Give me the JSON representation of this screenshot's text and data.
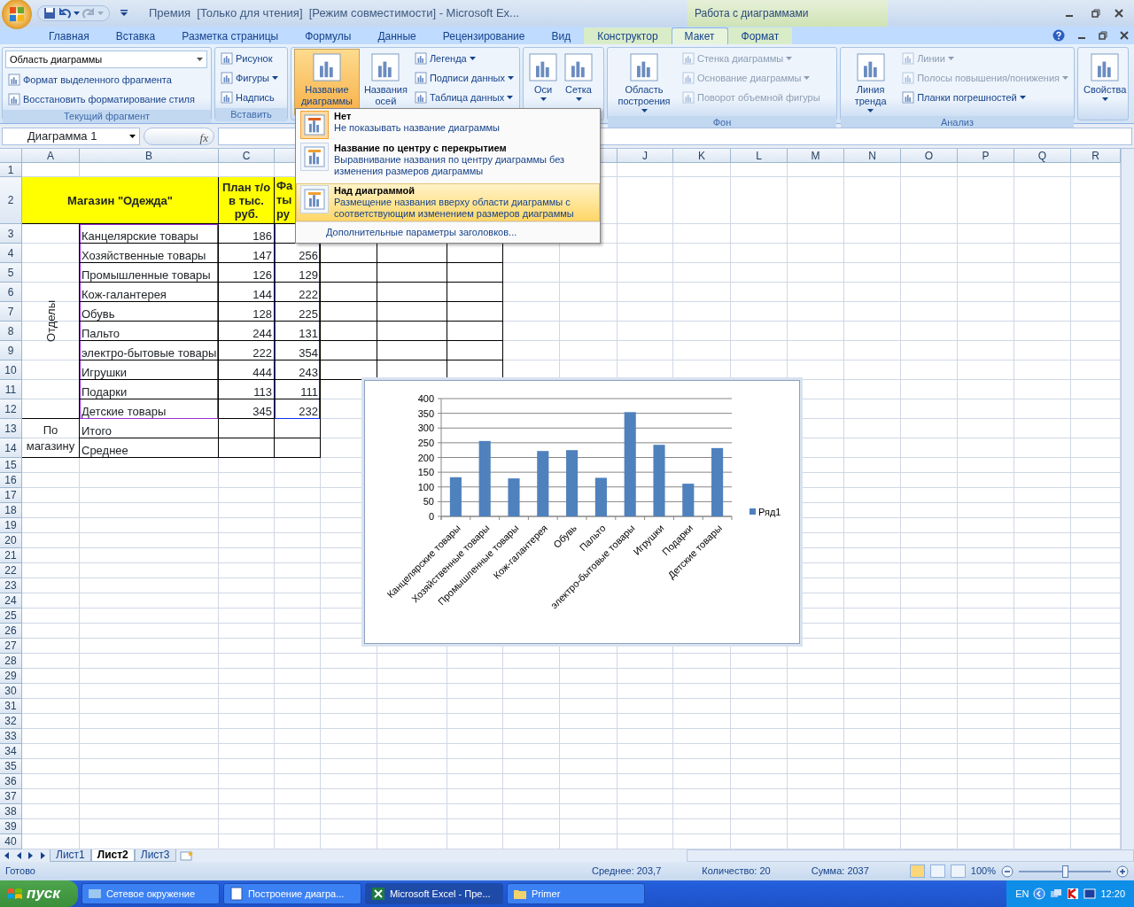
{
  "window": {
    "title": "Премия  [Только для чтения]  [Режим совместимости] - Microsoft Ex...",
    "context_title": "Работа с диаграммами"
  },
  "tabs": [
    {
      "label": "Главная",
      "selected": false,
      "contextual": false
    },
    {
      "label": "Вставка",
      "selected": false,
      "contextual": false
    },
    {
      "label": "Разметка страницы",
      "selected": false,
      "contextual": false
    },
    {
      "label": "Формулы",
      "selected": false,
      "contextual": false
    },
    {
      "label": "Данные",
      "selected": false,
      "contextual": false
    },
    {
      "label": "Рецензирование",
      "selected": false,
      "contextual": false
    },
    {
      "label": "Вид",
      "selected": false,
      "contextual": false
    },
    {
      "label": "Конструктор",
      "selected": false,
      "contextual": true
    },
    {
      "label": "Макет",
      "selected": true,
      "contextual": true
    },
    {
      "label": "Формат",
      "selected": false,
      "contextual": true
    }
  ],
  "ribbon": {
    "groups": [
      {
        "label": "Текущий фрагмент",
        "items": [
          {
            "kind": "combo",
            "label": "Область диаграммы",
            "dropdown": true,
            "disabled": false,
            "selected": false
          },
          {
            "kind": "small",
            "label": "Формат выделенного фрагмента",
            "dropdown": false,
            "disabled": false,
            "selected": false
          },
          {
            "kind": "small",
            "label": "Восстановить форматирование стиля",
            "dropdown": false,
            "disabled": false,
            "selected": false
          }
        ]
      },
      {
        "label": "Вставить",
        "items": [
          {
            "kind": "small",
            "label": "Рисунок",
            "dropdown": false,
            "disabled": false,
            "selected": false
          },
          {
            "kind": "small",
            "label": "Фигуры",
            "dropdown": true,
            "disabled": false,
            "selected": false
          },
          {
            "kind": "small",
            "label": "Надпись",
            "dropdown": false,
            "disabled": false,
            "selected": false
          }
        ]
      },
      {
        "items": [
          {
            "kind": "big",
            "label": "Название диаграммы",
            "dropdown": true,
            "disabled": false,
            "selected": true
          },
          {
            "kind": "big",
            "label": "Названия осей",
            "dropdown": true,
            "disabled": false,
            "selected": false
          },
          {
            "kind": "small",
            "label": "Легенда",
            "dropdown": true,
            "disabled": false,
            "selected": false
          },
          {
            "kind": "small",
            "label": "Подписи данных",
            "dropdown": true,
            "disabled": false,
            "selected": false
          },
          {
            "kind": "small",
            "label": "Таблица данных",
            "dropdown": true,
            "disabled": false,
            "selected": false
          }
        ]
      },
      {
        "items": [
          {
            "kind": "big",
            "label": "Оси",
            "dropdown": true,
            "disabled": false,
            "selected": false
          },
          {
            "kind": "big",
            "label": "Сетка",
            "dropdown": true,
            "disabled": false,
            "selected": false
          }
        ]
      },
      {
        "label": "Фон",
        "items": [
          {
            "kind": "big",
            "label": "Область построения",
            "dropdown": true,
            "disabled": false,
            "selected": false
          },
          {
            "kind": "small",
            "label": "Стенка диаграммы",
            "dropdown": true,
            "disabled": true,
            "selected": false
          },
          {
            "kind": "small",
            "label": "Основание диаграммы",
            "dropdown": true,
            "disabled": true,
            "selected": false
          },
          {
            "kind": "small",
            "label": "Поворот объемной фигуры",
            "dropdown": false,
            "disabled": true,
            "selected": false
          }
        ]
      },
      {
        "label": "Анализ",
        "items": [
          {
            "kind": "big",
            "label": "Линия тренда",
            "dropdown": true,
            "disabled": false,
            "selected": false
          },
          {
            "kind": "small",
            "label": "Линии",
            "dropdown": true,
            "disabled": true,
            "selected": false
          },
          {
            "kind": "small",
            "label": "Полосы повышения/понижения",
            "dropdown": true,
            "disabled": true,
            "selected": false
          },
          {
            "kind": "small",
            "label": "Планки погрешностей",
            "dropdown": true,
            "disabled": false,
            "selected": false
          }
        ]
      },
      {
        "items": [
          {
            "kind": "big",
            "label": "Свойства",
            "dropdown": true,
            "disabled": false,
            "selected": false
          }
        ]
      }
    ]
  },
  "dropdown_menu": {
    "items": [
      {
        "kind": "option",
        "title": "Нет",
        "description": "Не показывать название диаграммы",
        "selected": false,
        "current": true
      },
      {
        "kind": "option",
        "title": "Название по центру с перекрытием",
        "description": "Выравнивание названия по центру диаграммы без изменения размеров диаграммы",
        "selected": false,
        "current": false
      },
      {
        "kind": "option",
        "title": "Над диаграммой",
        "description": "Размещение названия вверху области диаграммы с соответствующим изменением размеров диаграммы",
        "selected": true,
        "current": false
      },
      {
        "kind": "link",
        "title": "Дополнительные параметры заголовков...",
        "selected": false
      }
    ]
  },
  "formula_bar": {
    "name_box": "Диаграмма 1",
    "fx_label": "fx"
  },
  "sheet": {
    "column_headers": [
      "A",
      "B",
      "C",
      "J",
      "K",
      "L",
      "M",
      "N",
      "O",
      "P",
      "Q",
      "R"
    ],
    "row_headers": [
      "1",
      "2",
      "3",
      "4",
      "5",
      "6",
      "7",
      "8",
      "9",
      "10",
      "11",
      "12",
      "13",
      "14",
      "15",
      "16",
      "17",
      "18",
      "19",
      "20",
      "21",
      "22",
      "23",
      "24",
      "25",
      "26",
      "27",
      "28",
      "29",
      "30",
      "31",
      "32",
      "33",
      "34",
      "35",
      "36",
      "37",
      "38",
      "39",
      "40"
    ],
    "header": {
      "title": "Магазин \"Одежда\"",
      "plan": "План т/о в тыс. руб.",
      "fact": "Фа ты ру"
    },
    "group_label": "Отделы",
    "items": [
      {
        "name": "Канцелярские товары",
        "plan": "186"
      },
      {
        "name": "Хозяйственные товары",
        "plan": "147",
        "fact": "256"
      },
      {
        "name": "Промышленные товары",
        "plan": "126",
        "fact": "129"
      },
      {
        "name": "Кож-галантерея",
        "plan": "144",
        "fact": "222"
      },
      {
        "name": "Обувь",
        "plan": "128",
        "fact": "225"
      },
      {
        "name": "Пальто",
        "plan": "244",
        "fact": "131"
      },
      {
        "name": "электро-бытовые товары",
        "plan": "222",
        "fact": "354"
      },
      {
        "name": "Игрушки",
        "plan": "444",
        "fact": "243"
      },
      {
        "name": "Подарки",
        "plan": "113",
        "fact": "111"
      },
      {
        "name": "Детские товары",
        "plan": "345",
        "fact": "232"
      }
    ],
    "totals_label": "По магазину",
    "totals": [
      {
        "name": "Итого"
      },
      {
        "name": "Среднее"
      }
    ]
  },
  "chart": {
    "chart_data": {
      "type": "bar",
      "categories": [
        "Канцелярские товары",
        "Хозяйственные товары",
        "Промышленные товары",
        "Кож-галантерея",
        "Обувь",
        "Пальто",
        "электро-бытовые товары",
        "Игрушки",
        "Подарки",
        "Детские товары"
      ],
      "series": [
        {
          "name": "Ряд1",
          "color": "#4f81bd",
          "values": [
            133,
            256,
            129,
            222,
            225,
            131,
            354,
            243,
            111,
            232
          ]
        }
      ],
      "ylim": [
        0,
        400
      ],
      "grid": true,
      "yticks": [
        0,
        50,
        100,
        150,
        200,
        250,
        300,
        350,
        400
      ]
    }
  },
  "sheet_tabs": [
    {
      "label": "Лист1",
      "selected": false
    },
    {
      "label": "Лист2",
      "selected": true
    },
    {
      "label": "Лист3",
      "selected": false
    }
  ],
  "status_bar": {
    "status": "Готово",
    "stats": [
      "Среднее: 203,7",
      "Количество: 20",
      "Сумма: 2037"
    ],
    "views": [
      {
        "selected": true
      },
      {
        "selected": false
      },
      {
        "selected": false
      }
    ],
    "zoom": "100%",
    "zoom_level": {
      "level": 0.5
    }
  },
  "taskbar": {
    "start": "пуск",
    "tasks": [
      {
        "label": "Сетевое окружение",
        "selected": false
      },
      {
        "label": "Построение диагра...",
        "selected": false
      },
      {
        "label": "Microsoft Excel - Пре...",
        "selected": true
      },
      {
        "label": "Primer",
        "selected": false
      }
    ],
    "language": "EN",
    "clock": "12:20"
  }
}
